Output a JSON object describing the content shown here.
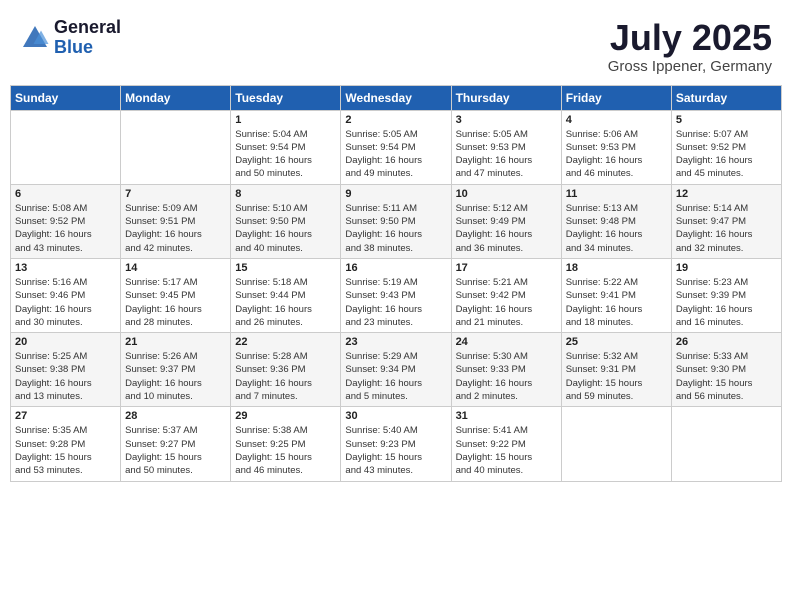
{
  "header": {
    "logo_general": "General",
    "logo_blue": "Blue",
    "month_year": "July 2025",
    "location": "Gross Ippener, Germany"
  },
  "weekdays": [
    "Sunday",
    "Monday",
    "Tuesday",
    "Wednesday",
    "Thursday",
    "Friday",
    "Saturday"
  ],
  "weeks": [
    [
      {
        "day": "",
        "info": ""
      },
      {
        "day": "",
        "info": ""
      },
      {
        "day": "1",
        "info": "Sunrise: 5:04 AM\nSunset: 9:54 PM\nDaylight: 16 hours\nand 50 minutes."
      },
      {
        "day": "2",
        "info": "Sunrise: 5:05 AM\nSunset: 9:54 PM\nDaylight: 16 hours\nand 49 minutes."
      },
      {
        "day": "3",
        "info": "Sunrise: 5:05 AM\nSunset: 9:53 PM\nDaylight: 16 hours\nand 47 minutes."
      },
      {
        "day": "4",
        "info": "Sunrise: 5:06 AM\nSunset: 9:53 PM\nDaylight: 16 hours\nand 46 minutes."
      },
      {
        "day": "5",
        "info": "Sunrise: 5:07 AM\nSunset: 9:52 PM\nDaylight: 16 hours\nand 45 minutes."
      }
    ],
    [
      {
        "day": "6",
        "info": "Sunrise: 5:08 AM\nSunset: 9:52 PM\nDaylight: 16 hours\nand 43 minutes."
      },
      {
        "day": "7",
        "info": "Sunrise: 5:09 AM\nSunset: 9:51 PM\nDaylight: 16 hours\nand 42 minutes."
      },
      {
        "day": "8",
        "info": "Sunrise: 5:10 AM\nSunset: 9:50 PM\nDaylight: 16 hours\nand 40 minutes."
      },
      {
        "day": "9",
        "info": "Sunrise: 5:11 AM\nSunset: 9:50 PM\nDaylight: 16 hours\nand 38 minutes."
      },
      {
        "day": "10",
        "info": "Sunrise: 5:12 AM\nSunset: 9:49 PM\nDaylight: 16 hours\nand 36 minutes."
      },
      {
        "day": "11",
        "info": "Sunrise: 5:13 AM\nSunset: 9:48 PM\nDaylight: 16 hours\nand 34 minutes."
      },
      {
        "day": "12",
        "info": "Sunrise: 5:14 AM\nSunset: 9:47 PM\nDaylight: 16 hours\nand 32 minutes."
      }
    ],
    [
      {
        "day": "13",
        "info": "Sunrise: 5:16 AM\nSunset: 9:46 PM\nDaylight: 16 hours\nand 30 minutes."
      },
      {
        "day": "14",
        "info": "Sunrise: 5:17 AM\nSunset: 9:45 PM\nDaylight: 16 hours\nand 28 minutes."
      },
      {
        "day": "15",
        "info": "Sunrise: 5:18 AM\nSunset: 9:44 PM\nDaylight: 16 hours\nand 26 minutes."
      },
      {
        "day": "16",
        "info": "Sunrise: 5:19 AM\nSunset: 9:43 PM\nDaylight: 16 hours\nand 23 minutes."
      },
      {
        "day": "17",
        "info": "Sunrise: 5:21 AM\nSunset: 9:42 PM\nDaylight: 16 hours\nand 21 minutes."
      },
      {
        "day": "18",
        "info": "Sunrise: 5:22 AM\nSunset: 9:41 PM\nDaylight: 16 hours\nand 18 minutes."
      },
      {
        "day": "19",
        "info": "Sunrise: 5:23 AM\nSunset: 9:39 PM\nDaylight: 16 hours\nand 16 minutes."
      }
    ],
    [
      {
        "day": "20",
        "info": "Sunrise: 5:25 AM\nSunset: 9:38 PM\nDaylight: 16 hours\nand 13 minutes."
      },
      {
        "day": "21",
        "info": "Sunrise: 5:26 AM\nSunset: 9:37 PM\nDaylight: 16 hours\nand 10 minutes."
      },
      {
        "day": "22",
        "info": "Sunrise: 5:28 AM\nSunset: 9:36 PM\nDaylight: 16 hours\nand 7 minutes."
      },
      {
        "day": "23",
        "info": "Sunrise: 5:29 AM\nSunset: 9:34 PM\nDaylight: 16 hours\nand 5 minutes."
      },
      {
        "day": "24",
        "info": "Sunrise: 5:30 AM\nSunset: 9:33 PM\nDaylight: 16 hours\nand 2 minutes."
      },
      {
        "day": "25",
        "info": "Sunrise: 5:32 AM\nSunset: 9:31 PM\nDaylight: 15 hours\nand 59 minutes."
      },
      {
        "day": "26",
        "info": "Sunrise: 5:33 AM\nSunset: 9:30 PM\nDaylight: 15 hours\nand 56 minutes."
      }
    ],
    [
      {
        "day": "27",
        "info": "Sunrise: 5:35 AM\nSunset: 9:28 PM\nDaylight: 15 hours\nand 53 minutes."
      },
      {
        "day": "28",
        "info": "Sunrise: 5:37 AM\nSunset: 9:27 PM\nDaylight: 15 hours\nand 50 minutes."
      },
      {
        "day": "29",
        "info": "Sunrise: 5:38 AM\nSunset: 9:25 PM\nDaylight: 15 hours\nand 46 minutes."
      },
      {
        "day": "30",
        "info": "Sunrise: 5:40 AM\nSunset: 9:23 PM\nDaylight: 15 hours\nand 43 minutes."
      },
      {
        "day": "31",
        "info": "Sunrise: 5:41 AM\nSunset: 9:22 PM\nDaylight: 15 hours\nand 40 minutes."
      },
      {
        "day": "",
        "info": ""
      },
      {
        "day": "",
        "info": ""
      }
    ]
  ]
}
